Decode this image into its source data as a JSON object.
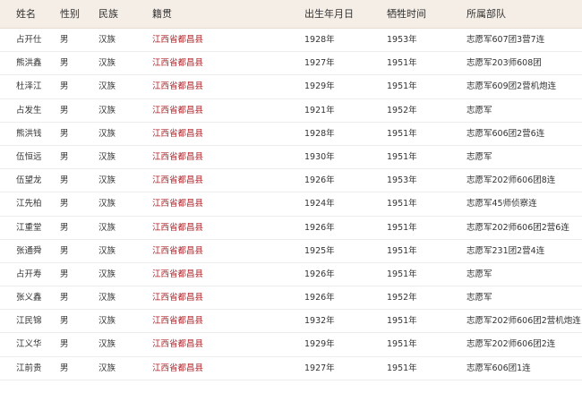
{
  "headers": {
    "name": "姓名",
    "gender": "性别",
    "ethnicity": "民族",
    "origin": "籍贯",
    "birth": "出生年月日",
    "death": "牺牲时间",
    "unit": "所属部队"
  },
  "colors": {
    "header_bg": "#f5eee6",
    "origin_text": "#b0242a",
    "row_divider": "#ececec"
  },
  "rows": [
    {
      "name": "占开仕",
      "gender": "男",
      "ethnicity": "汉族",
      "origin": "江西省都昌县",
      "birth": "1928年",
      "death": "1953年",
      "unit": "志愿军607团3营7连"
    },
    {
      "name": "熊洪鑫",
      "gender": "男",
      "ethnicity": "汉族",
      "origin": "江西省都昌县",
      "birth": "1927年",
      "death": "1951年",
      "unit": "志愿军203师608团"
    },
    {
      "name": "杜泽江",
      "gender": "男",
      "ethnicity": "汉族",
      "origin": "江西省都昌县",
      "birth": "1929年",
      "death": "1951年",
      "unit": "志愿军609团2营机炮连"
    },
    {
      "name": "占发生",
      "gender": "男",
      "ethnicity": "汉族",
      "origin": "江西省都昌县",
      "birth": "1921年",
      "death": "1952年",
      "unit": "志愿军"
    },
    {
      "name": "熊洪钱",
      "gender": "男",
      "ethnicity": "汉族",
      "origin": "江西省都昌县",
      "birth": "1928年",
      "death": "1951年",
      "unit": "志愿军606团2营6连"
    },
    {
      "name": "伍恒远",
      "gender": "男",
      "ethnicity": "汉族",
      "origin": "江西省都昌县",
      "birth": "1930年",
      "death": "1951年",
      "unit": "志愿军"
    },
    {
      "name": "伍望龙",
      "gender": "男",
      "ethnicity": "汉族",
      "origin": "江西省都昌县",
      "birth": "1926年",
      "death": "1953年",
      "unit": "志愿军202师606团8连"
    },
    {
      "name": "江先柏",
      "gender": "男",
      "ethnicity": "汉族",
      "origin": "江西省都昌县",
      "birth": "1924年",
      "death": "1951年",
      "unit": "志愿军45师侦察连"
    },
    {
      "name": "江重堂",
      "gender": "男",
      "ethnicity": "汉族",
      "origin": "江西省都昌县",
      "birth": "1926年",
      "death": "1951年",
      "unit": "志愿军202师606团2营6连"
    },
    {
      "name": "张通舜",
      "gender": "男",
      "ethnicity": "汉族",
      "origin": "江西省都昌县",
      "birth": "1925年",
      "death": "1951年",
      "unit": "志愿军231团2营4连"
    },
    {
      "name": "占开寿",
      "gender": "男",
      "ethnicity": "汉族",
      "origin": "江西省都昌县",
      "birth": "1926年",
      "death": "1951年",
      "unit": "志愿军"
    },
    {
      "name": "张义鑫",
      "gender": "男",
      "ethnicity": "汉族",
      "origin": "江西省都昌县",
      "birth": "1926年",
      "death": "1952年",
      "unit": "志愿军"
    },
    {
      "name": "江民锦",
      "gender": "男",
      "ethnicity": "汉族",
      "origin": "江西省都昌县",
      "birth": "1932年",
      "death": "1951年",
      "unit": "志愿军202师606团2营机炮连"
    },
    {
      "name": "江义华",
      "gender": "男",
      "ethnicity": "汉族",
      "origin": "江西省都昌县",
      "birth": "1929年",
      "death": "1951年",
      "unit": "志愿军202师606团2连"
    },
    {
      "name": "江前贵",
      "gender": "男",
      "ethnicity": "汉族",
      "origin": "江西省都昌县",
      "birth": "1927年",
      "death": "1951年",
      "unit": "志愿军606团1连"
    }
  ]
}
